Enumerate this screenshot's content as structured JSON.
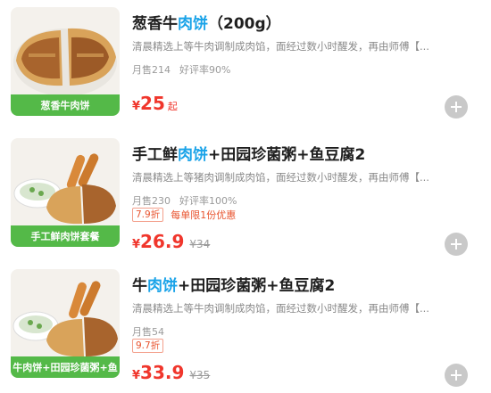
{
  "products": [
    {
      "title_prefix": "葱香牛",
      "title_highlight": "肉饼",
      "title_suffix": "（200g）",
      "description": "清晨精选上等牛肉调制成肉馅，面经过数小时醒发，再由师傅【...",
      "monthly_sales": "月售214",
      "rating": "好评率90%",
      "currency": "¥",
      "price": "25",
      "price_suffix": "起",
      "image_caption": "葱香牛肉饼",
      "add_icon": "plus-icon"
    },
    {
      "title_prefix": "手工鲜",
      "title_highlight": "肉饼",
      "title_suffix": "+田园珍菌粥+鱼豆腐2",
      "description": "清晨精选上等猪肉调制成肉馅，面经过数小时醒发，再由师傅【...",
      "monthly_sales": "月售230",
      "rating": "好评率100%",
      "discount": "7.9折",
      "limit_note": "每单限1份优惠",
      "currency": "¥",
      "price": "26.9",
      "original_price": "¥34",
      "image_caption": "手工鲜肉饼套餐",
      "add_icon": "plus-icon"
    },
    {
      "title_prefix": "牛",
      "title_highlight": "肉饼",
      "title_suffix": "+田园珍菌粥+鱼豆腐2",
      "description": "清晨精选上等牛肉调制成肉馅，面经过数小时醒发，再由师傅【...",
      "monthly_sales": "月售54",
      "discount": "9.7折",
      "currency": "¥",
      "price": "33.9",
      "original_price": "¥35",
      "image_caption": "牛肉饼+田园珍菌粥+鱼",
      "add_icon": "plus-icon"
    }
  ],
  "colors": {
    "highlight": "#1aa3e8",
    "price": "#f0362c",
    "caption_bg": "#54b948",
    "add_button": "#c9c9c9"
  }
}
